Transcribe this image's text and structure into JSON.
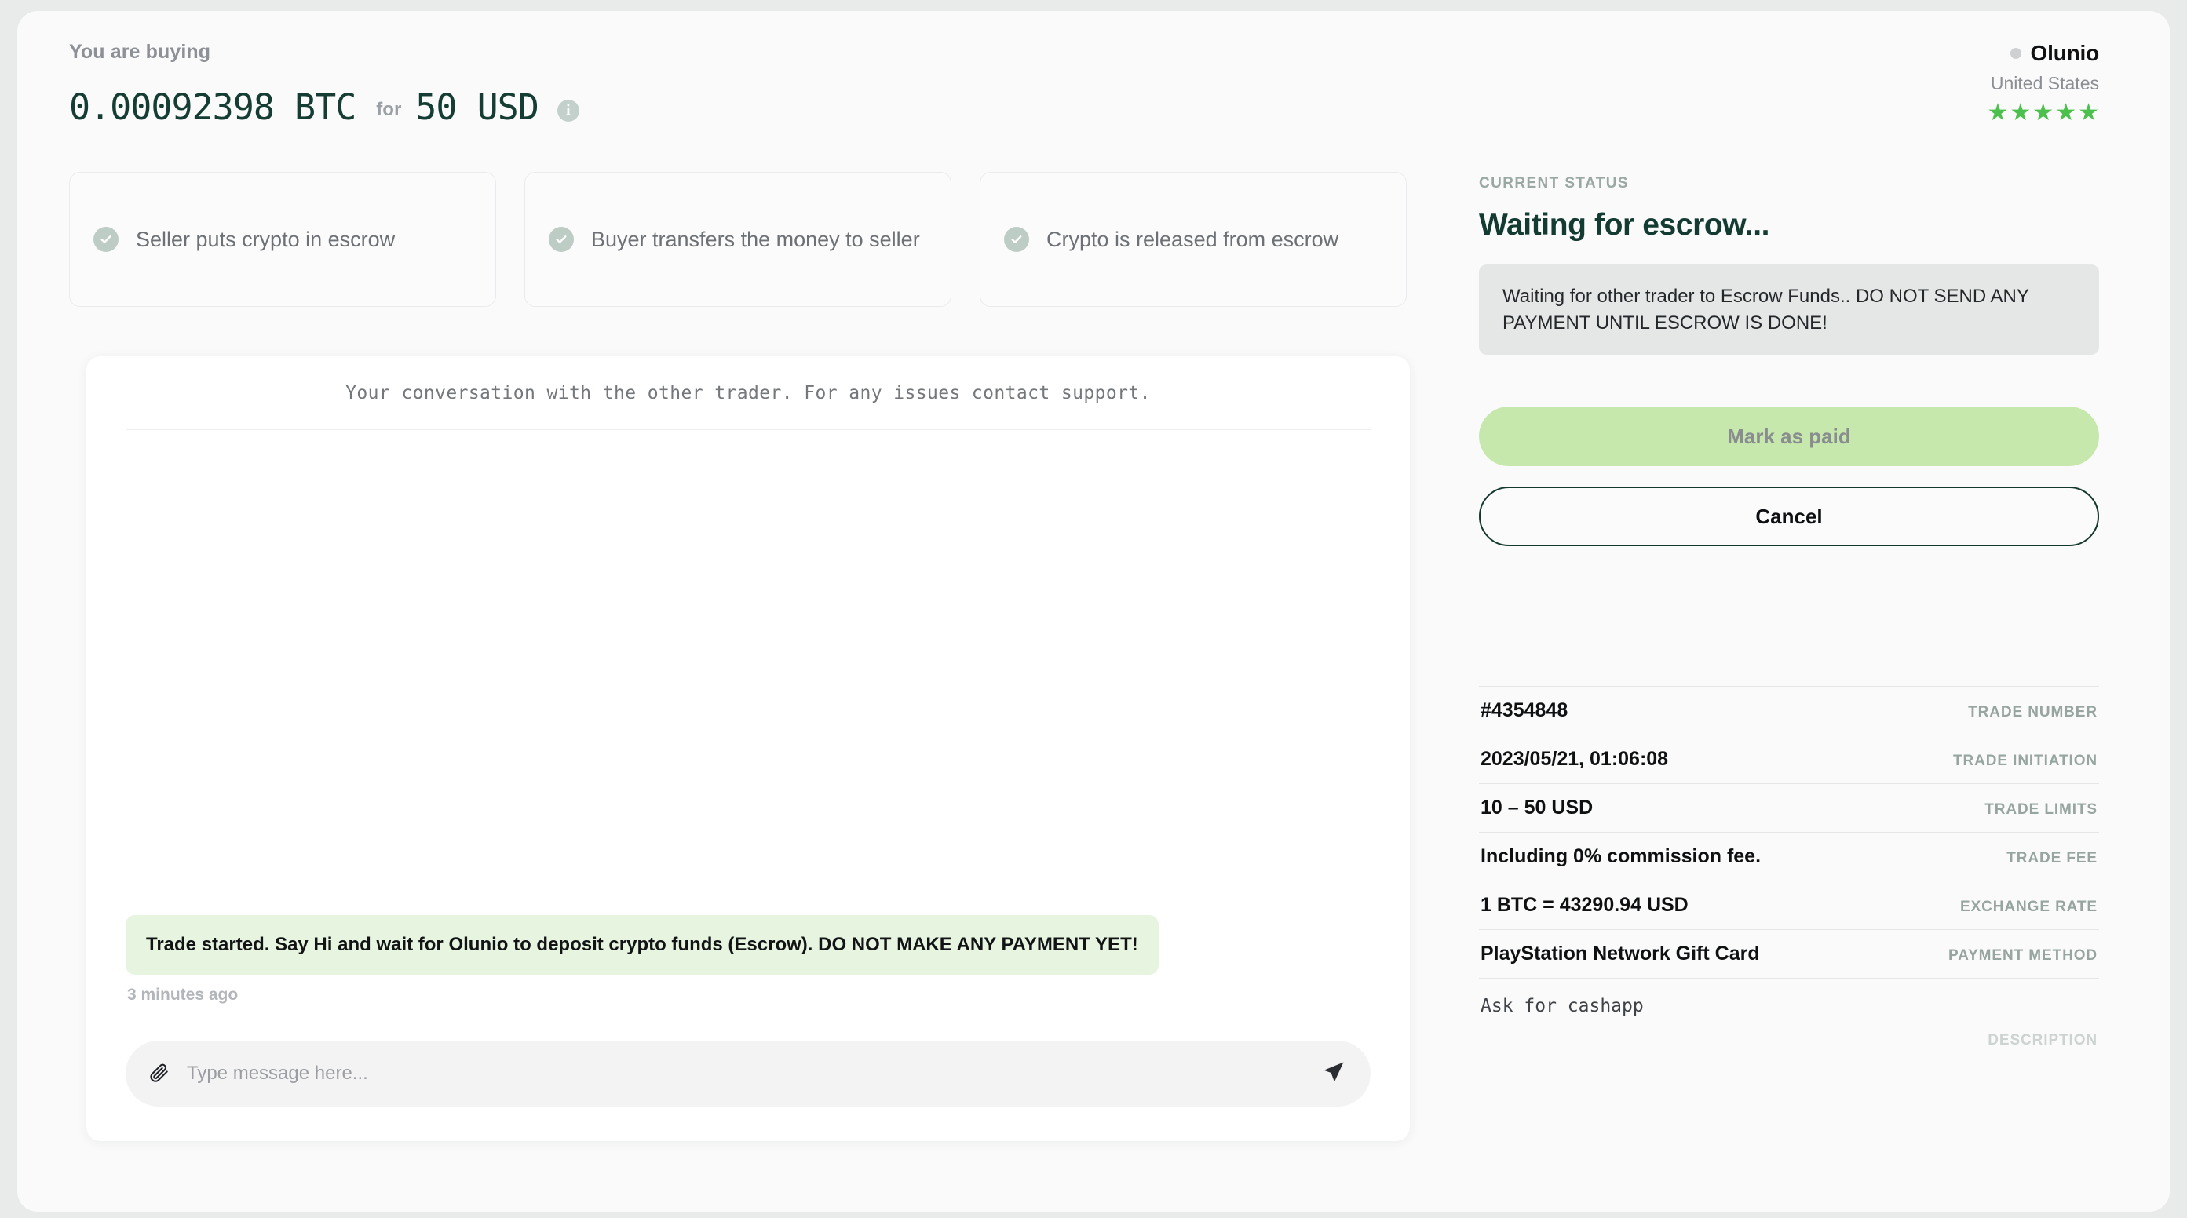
{
  "header": {
    "buying_label": "You are buying",
    "crypto_amount": "0.00092398 BTC",
    "for_label": "for",
    "fiat_amount": "50 USD",
    "info_icon_glyph": "i"
  },
  "steps": [
    {
      "icon": "check-circle-icon",
      "label": "Seller puts crypto in escrow"
    },
    {
      "icon": "check-circle-icon",
      "label": "Buyer transfers the money to seller"
    },
    {
      "icon": "check-circle-icon",
      "label": "Crypto is released from escrow"
    }
  ],
  "chat": {
    "header_note": "Your conversation with the other trader. For any issues contact support.",
    "messages": [
      {
        "text": "Trade started. Say Hi and wait for Olunio to deposit crypto funds (Escrow). DO NOT MAKE ANY PAYMENT YET!",
        "time": "3 minutes ago"
      }
    ],
    "input_placeholder": "Type message here...",
    "input_value": "",
    "attach_icon": "paperclip-icon",
    "send_icon": "send-icon"
  },
  "trader": {
    "name": "Olunio",
    "country": "United States",
    "online_status": "offline",
    "rating": 5,
    "stars": [
      "★",
      "★",
      "★",
      "★",
      "★"
    ]
  },
  "status": {
    "eyebrow": "CURRENT STATUS",
    "title": "Waiting for escrow...",
    "message": "Waiting for other trader to Escrow Funds.. DO NOT SEND ANY PAYMENT UNTIL ESCROW IS DONE!"
  },
  "actions": {
    "mark_paid_label": "Mark as paid",
    "cancel_label": "Cancel"
  },
  "details": [
    {
      "value": "#4354848",
      "key": "TRADE NUMBER"
    },
    {
      "value": "2023/05/21, 01:06:08",
      "key": "TRADE INITIATION"
    },
    {
      "value": "10 – 50 USD",
      "key": "TRADE LIMITS"
    },
    {
      "value": "Including 0% commission fee.",
      "key": "TRADE FEE"
    },
    {
      "value": "1 BTC = 43290.94 USD",
      "key": "EXCHANGE RATE"
    },
    {
      "value": "PlayStation Network Gift Card",
      "key": "PAYMENT METHOD"
    }
  ],
  "description": {
    "value": "Ask for cashapp",
    "key": "DESCRIPTION"
  },
  "colors": {
    "accent_green": "#4cc04c",
    "dark_green": "#133b31",
    "bubble_green": "#e6f4e0",
    "button_green": "#c7e8ad"
  }
}
